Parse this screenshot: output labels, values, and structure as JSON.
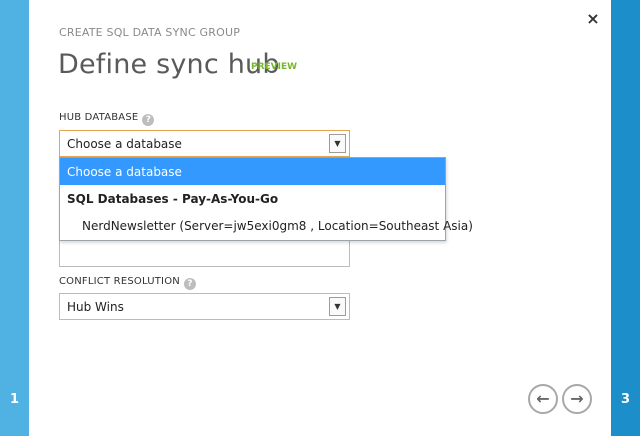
{
  "wizard": {
    "kicker": "CREATE SQL DATA SYNC GROUP",
    "title": "Define sync hub",
    "badge": "PREVIEW",
    "close_glyph": "×",
    "step_left": "1",
    "step_right": "3"
  },
  "hub_database": {
    "label": "HUB DATABASE",
    "help_glyph": "?",
    "selected": "Choose a database",
    "arrow_glyph": "▼",
    "options": [
      "Choose a database",
      "SQL Databases - Pay-As-You-Go",
      "NerdNewsletter (Server=jw5exi0gm8 , Location=Southeast Asia)"
    ]
  },
  "conflict_resolution": {
    "label": "CONFLICT RESOLUTION",
    "help_glyph": "?",
    "selected": "Hub Wins",
    "arrow_glyph": "▼"
  },
  "nav": {
    "back_glyph": "←",
    "next_glyph": "→"
  },
  "colors": {
    "left_bar": "#4fb2e3",
    "right_bar": "#1c8fca",
    "selected_option": "#3399ff",
    "preview_badge": "#77b82a",
    "focus_border": "#e5a54b"
  }
}
